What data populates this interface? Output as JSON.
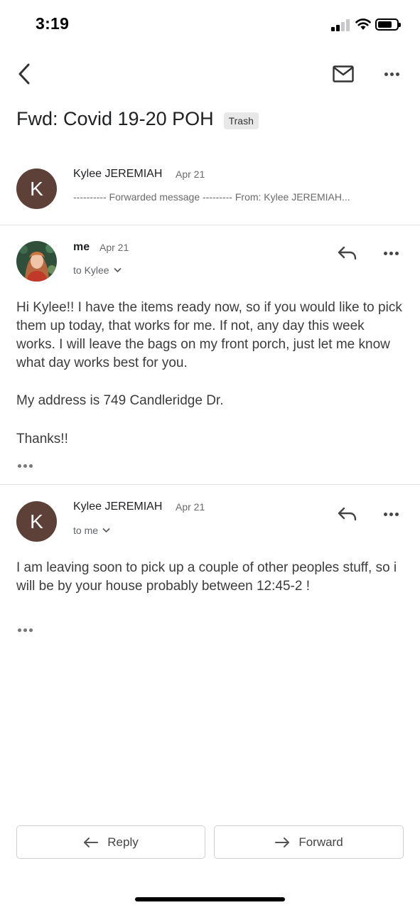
{
  "status_bar": {
    "time": "3:19"
  },
  "thread": {
    "subject": "Fwd: Covid 19-20 POH",
    "label": "Trash"
  },
  "messages": [
    {
      "avatar_letter": "K",
      "avatar_color": "#5d4037",
      "sender": "Kylee JEREMIAH",
      "date": "Apr 21",
      "snippet": "---------- Forwarded message --------- From: Kylee JEREMIAH..."
    },
    {
      "sender": "me",
      "date": "Apr 21",
      "recipient": "to Kylee",
      "body": [
        "Hi Kylee!! I have the items ready now, so if you would like to pick them up today, that works for me. If not, any day this week works. I will leave the bags on my front porch, just let me know what day works best for you.",
        "My address is 749 Candleridge Dr.",
        "Thanks!!"
      ]
    },
    {
      "avatar_letter": "K",
      "avatar_color": "#5d4037",
      "sender": "Kylee JEREMIAH",
      "date": "Apr 21",
      "recipient": "to me",
      "body": [
        "I am leaving soon to pick up a couple of other peoples stuff, so i will be by your house probably between 12:45-2 !"
      ]
    }
  ],
  "actions": {
    "reply_label": "Reply",
    "forward_label": "Forward"
  },
  "icons": {
    "back": "chevron-left-icon",
    "mail": "envelope-icon",
    "more": "more-horizontal-icon",
    "reply": "reply-arrow-icon",
    "forward": "forward-arrow-icon"
  }
}
